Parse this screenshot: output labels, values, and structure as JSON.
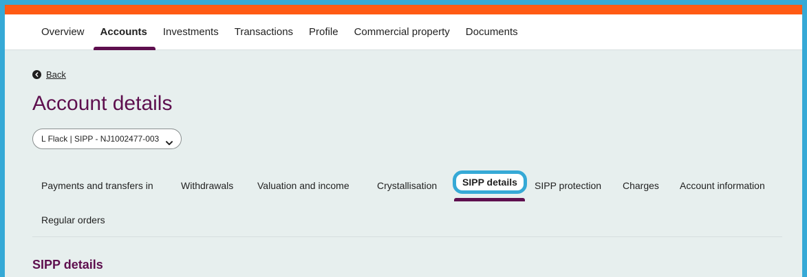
{
  "nav": {
    "items": [
      "Overview",
      "Accounts",
      "Investments",
      "Transactions",
      "Profile",
      "Commercial property",
      "Documents"
    ],
    "active": "Accounts"
  },
  "back": {
    "label": "Back",
    "icon": "chevron-left-icon"
  },
  "page_title": "Account details",
  "account_select": {
    "value": "L Flack | SIPP - NJ1002477-003",
    "icon": "chevron-down-icon"
  },
  "tabs": {
    "items": [
      "Payments and transfers in",
      "Withdrawals",
      "Valuation and income",
      "Crystallisation",
      "SIPP details",
      "SIPP protection",
      "Charges",
      "Account information",
      "Regular orders"
    ],
    "active": "SIPP details"
  },
  "section_title": "SIPP details",
  "colors": {
    "accent_bar": "#ff5a14",
    "brand_purple": "#5e0f4e",
    "highlight_blue": "#36a9d6",
    "background": "#e7efee"
  }
}
